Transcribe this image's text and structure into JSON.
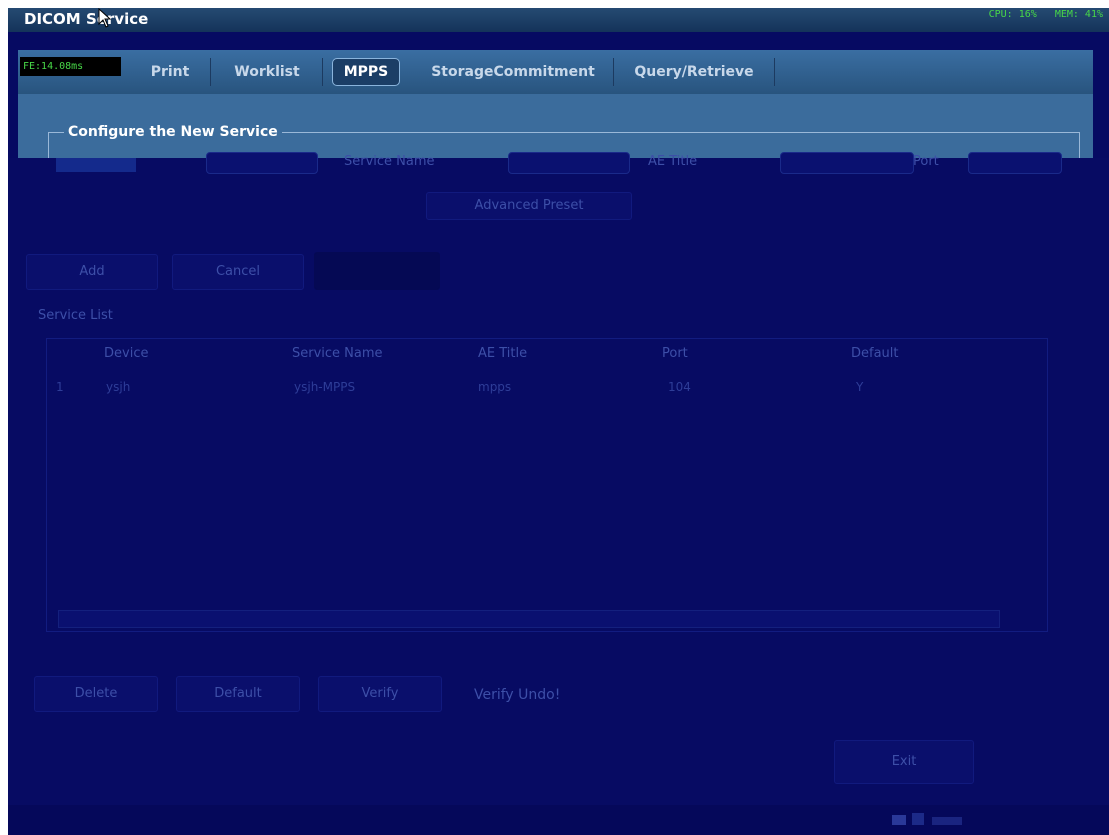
{
  "app": {
    "title": "DICOM Service"
  },
  "status": {
    "cpu": "CPU: 16%",
    "mem": "MEM: 41%",
    "frame_time": "FE:14.08ms"
  },
  "tabs": [
    {
      "label": "Print",
      "active": false
    },
    {
      "label": "Worklist",
      "active": false
    },
    {
      "label": "MPPS",
      "active": true
    },
    {
      "label": "StorageCommitment",
      "active": false
    },
    {
      "label": "Query/Retrieve",
      "active": false
    }
  ],
  "config": {
    "group_title": "Configure the New Service",
    "service_name_label": "Service Name",
    "ae_title_label": "AE Title",
    "port_label": "Port",
    "advanced_preset_label": "Advanced Preset"
  },
  "actions": {
    "add": "Add",
    "cancel": "Cancel"
  },
  "service_list": {
    "label": "Service List",
    "columns": [
      "Device",
      "Service Name",
      "AE Title",
      "Port",
      "Default"
    ],
    "rows": [
      {
        "num": "1",
        "device": "ysjh",
        "service_name": "ysjh-MPPS",
        "ae_title": "mpps",
        "port": "104",
        "default": "Y"
      }
    ]
  },
  "list_actions": {
    "delete": "Delete",
    "default": "Default",
    "verify": "Verify",
    "verify_status": "Verify Undo!"
  },
  "exit_label": "Exit",
  "colors": {
    "accent": "#3b6c9c",
    "overlay": "#070b63",
    "status_green": "#48d848"
  }
}
